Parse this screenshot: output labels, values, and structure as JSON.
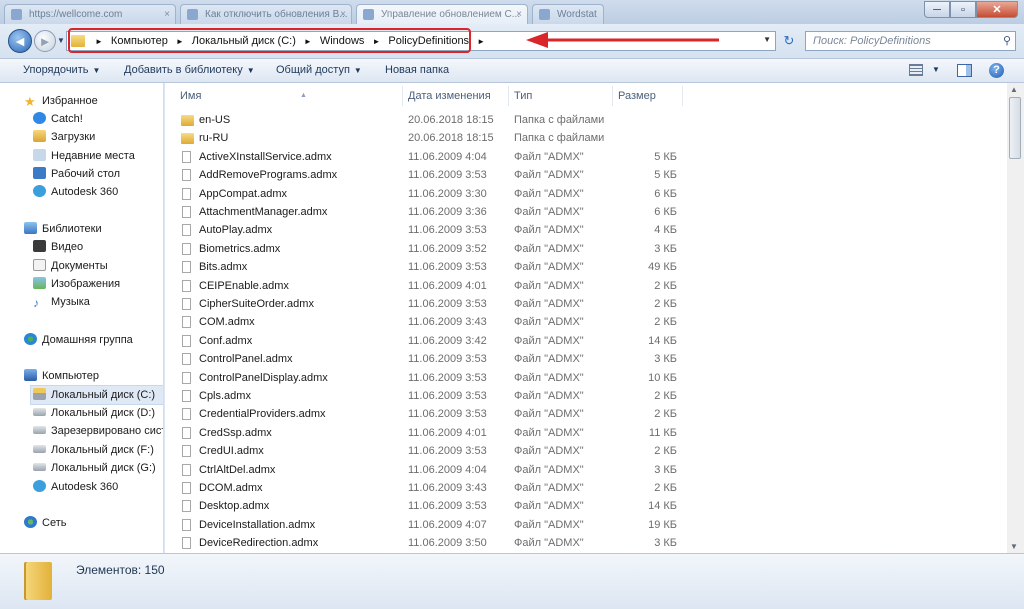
{
  "tabs": [
    {
      "label": "https://wellcome.com"
    },
    {
      "label": "Как отключить обновления В..."
    },
    {
      "label": "Управление обновлением С..."
    },
    {
      "label": "Wordstat"
    }
  ],
  "window_buttons": {
    "minimize": "─",
    "maximize": "▫",
    "close": "✕"
  },
  "nav": {
    "back": "◄",
    "forward": "►",
    "address_crumbs": [
      "Компьютер",
      "Локальный диск (C:)",
      "Windows",
      "PolicyDefinitions"
    ],
    "crumb_sep": "►",
    "search_placeholder": "Поиск: PolicyDefinitions"
  },
  "toolbar": {
    "organize": "Упорядочить",
    "add_library": "Добавить в библиотеку",
    "share": "Общий доступ",
    "new_folder": "Новая папка",
    "help": "?"
  },
  "sidebar": {
    "groups": [
      {
        "title": "Избранное",
        "icon": "star-icon",
        "items": [
          {
            "label": "Catch!",
            "icon": "catch-icon"
          },
          {
            "label": "Загрузки",
            "icon": "downloads-icon"
          },
          {
            "label": "Недавние места",
            "icon": "recent-places-icon"
          },
          {
            "label": "Рабочий стол",
            "icon": "desktop-icon"
          },
          {
            "label": "Autodesk 360",
            "icon": "cloud-icon"
          }
        ]
      },
      {
        "title": "Библиотеки",
        "icon": "libraries-icon",
        "items": [
          {
            "label": "Видео",
            "icon": "video-icon"
          },
          {
            "label": "Документы",
            "icon": "documents-icon"
          },
          {
            "label": "Изображения",
            "icon": "images-icon"
          },
          {
            "label": "Музыка",
            "icon": "music-icon"
          }
        ]
      },
      {
        "title": "Домашняя группа",
        "icon": "homegroup-icon",
        "items": []
      },
      {
        "title": "Компьютер",
        "icon": "computer-icon",
        "items": [
          {
            "label": "Локальный диск (C:)",
            "icon": "drive-c-icon",
            "selected": true
          },
          {
            "label": "Локальный диск (D:)",
            "icon": "drive-icon"
          },
          {
            "label": "Зарезервировано системой",
            "icon": "drive-icon"
          },
          {
            "label": "Локальный диск (F:)",
            "icon": "drive-icon"
          },
          {
            "label": "Локальный диск (G:)",
            "icon": "drive-icon"
          },
          {
            "label": "Autodesk 360",
            "icon": "cloud-icon"
          }
        ]
      },
      {
        "title": "Сеть",
        "icon": "network-icon",
        "items": []
      }
    ]
  },
  "columns": {
    "name": "Имя",
    "date": "Дата изменения",
    "type": "Тип",
    "size": "Размер"
  },
  "files": [
    {
      "name": "en-US",
      "date": "20.06.2018 18:15",
      "type": "Папка с файлами",
      "size": "",
      "kind": "folder"
    },
    {
      "name": "ru-RU",
      "date": "20.06.2018 18:15",
      "type": "Папка с файлами",
      "size": "",
      "kind": "folder"
    },
    {
      "name": "ActiveXInstallService.admx",
      "date": "11.06.2009 4:04",
      "type": "Файл \"ADMX\"",
      "size": "5 КБ",
      "kind": "file"
    },
    {
      "name": "AddRemovePrograms.admx",
      "date": "11.06.2009 3:53",
      "type": "Файл \"ADMX\"",
      "size": "5 КБ",
      "kind": "file"
    },
    {
      "name": "AppCompat.admx",
      "date": "11.06.2009 3:30",
      "type": "Файл \"ADMX\"",
      "size": "6 КБ",
      "kind": "file"
    },
    {
      "name": "AttachmentManager.admx",
      "date": "11.06.2009 3:36",
      "type": "Файл \"ADMX\"",
      "size": "6 КБ",
      "kind": "file"
    },
    {
      "name": "AutoPlay.admx",
      "date": "11.06.2009 3:53",
      "type": "Файл \"ADMX\"",
      "size": "4 КБ",
      "kind": "file"
    },
    {
      "name": "Biometrics.admx",
      "date": "11.06.2009 3:52",
      "type": "Файл \"ADMX\"",
      "size": "3 КБ",
      "kind": "file"
    },
    {
      "name": "Bits.admx",
      "date": "11.06.2009 3:53",
      "type": "Файл \"ADMX\"",
      "size": "49 КБ",
      "kind": "file"
    },
    {
      "name": "CEIPEnable.admx",
      "date": "11.06.2009 4:01",
      "type": "Файл \"ADMX\"",
      "size": "2 КБ",
      "kind": "file"
    },
    {
      "name": "CipherSuiteOrder.admx",
      "date": "11.06.2009 3:53",
      "type": "Файл \"ADMX\"",
      "size": "2 КБ",
      "kind": "file"
    },
    {
      "name": "COM.admx",
      "date": "11.06.2009 3:43",
      "type": "Файл \"ADMX\"",
      "size": "2 КБ",
      "kind": "file"
    },
    {
      "name": "Conf.admx",
      "date": "11.06.2009 3:42",
      "type": "Файл \"ADMX\"",
      "size": "14 КБ",
      "kind": "file"
    },
    {
      "name": "ControlPanel.admx",
      "date": "11.06.2009 3:53",
      "type": "Файл \"ADMX\"",
      "size": "3 КБ",
      "kind": "file"
    },
    {
      "name": "ControlPanelDisplay.admx",
      "date": "11.06.2009 3:53",
      "type": "Файл \"ADMX\"",
      "size": "10 КБ",
      "kind": "file"
    },
    {
      "name": "Cpls.admx",
      "date": "11.06.2009 3:53",
      "type": "Файл \"ADMX\"",
      "size": "2 КБ",
      "kind": "file"
    },
    {
      "name": "CredentialProviders.admx",
      "date": "11.06.2009 3:53",
      "type": "Файл \"ADMX\"",
      "size": "2 КБ",
      "kind": "file"
    },
    {
      "name": "CredSsp.admx",
      "date": "11.06.2009 4:01",
      "type": "Файл \"ADMX\"",
      "size": "11 КБ",
      "kind": "file"
    },
    {
      "name": "CredUI.admx",
      "date": "11.06.2009 3:53",
      "type": "Файл \"ADMX\"",
      "size": "2 КБ",
      "kind": "file"
    },
    {
      "name": "CtrlAltDel.admx",
      "date": "11.06.2009 4:04",
      "type": "Файл \"ADMX\"",
      "size": "3 КБ",
      "kind": "file"
    },
    {
      "name": "DCOM.admx",
      "date": "11.06.2009 3:43",
      "type": "Файл \"ADMX\"",
      "size": "2 КБ",
      "kind": "file"
    },
    {
      "name": "Desktop.admx",
      "date": "11.06.2009 3:53",
      "type": "Файл \"ADMX\"",
      "size": "14 КБ",
      "kind": "file"
    },
    {
      "name": "DeviceInstallation.admx",
      "date": "11.06.2009 4:07",
      "type": "Файл \"ADMX\"",
      "size": "19 КБ",
      "kind": "file"
    },
    {
      "name": "DeviceRedirection.admx",
      "date": "11.06.2009 3:50",
      "type": "Файл \"ADMX\"",
      "size": "3 КБ",
      "kind": "file"
    }
  ],
  "status": {
    "count_label": "Элементов: 150"
  },
  "colors": {
    "highlight": "#d8262a",
    "accent": "#2a66b4"
  }
}
